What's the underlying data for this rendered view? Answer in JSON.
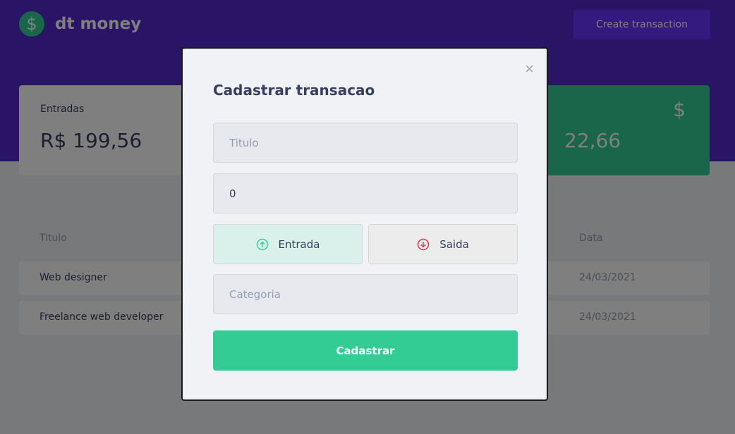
{
  "header": {
    "logo_symbol": "$",
    "app_name": "dt money",
    "create_button_label": "Create transaction"
  },
  "summary": {
    "income": {
      "label": "Entradas",
      "value": "R$ 199,56"
    },
    "total": {
      "value": "22,66",
      "icon": "dollar-icon"
    }
  },
  "table": {
    "headers": {
      "title": "Titulo",
      "date": "Data"
    },
    "rows": [
      {
        "title": "Web designer",
        "date": "24/03/2021"
      },
      {
        "title": "Freelance web developer",
        "date": "24/03/2021"
      }
    ]
  },
  "modal": {
    "close_symbol": "×",
    "title": "Cadastrar transacao",
    "title_placeholder": "Titulo",
    "amount_value": "0",
    "type_income_label": "Entrada",
    "type_outcome_label": "Saida",
    "category_placeholder": "Categoria",
    "submit_label": "Cadastrar"
  },
  "colors": {
    "header_bg": "#5429cc",
    "green": "#33cc95",
    "red": "#e52e4d",
    "button_bg": "#6933ff"
  }
}
